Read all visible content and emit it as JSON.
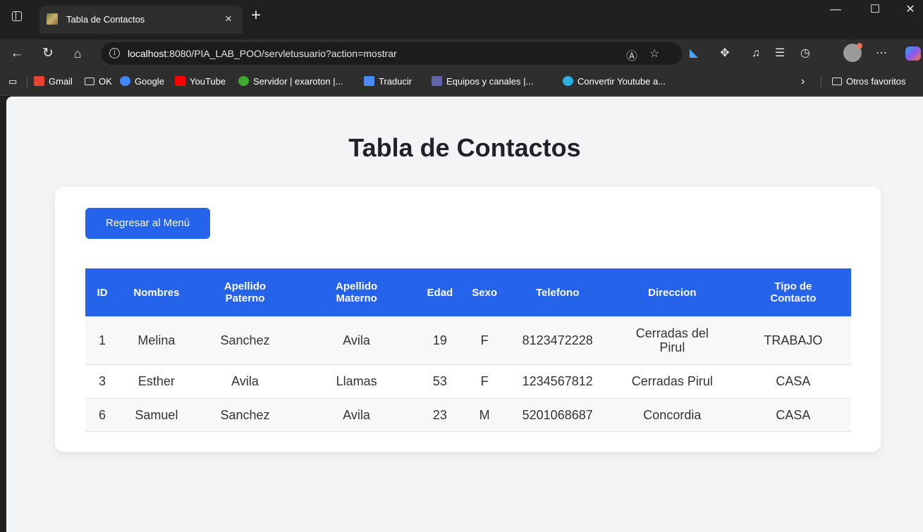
{
  "browser": {
    "tab_title": "Tabla de Contactos",
    "tab_close": "×",
    "new_tab": "+",
    "url_host": "localhost",
    "url_rest": ":8080/PIA_LAB_POO/servletusuario?action=mostrar",
    "bookmarks": [
      {
        "label": "Gmail",
        "icon": "gmail-icon",
        "color": "#ea4335"
      },
      {
        "label": "OK",
        "icon": "folder-icon",
        "color": "#e6e6e6"
      },
      {
        "label": "Google",
        "icon": "google-icon",
        "color": "#4285f4"
      },
      {
        "label": "YouTube",
        "icon": "youtube-icon",
        "color": "#ff0000"
      },
      {
        "label": "Servidor | exaroton |...",
        "icon": "exaroton-icon",
        "color": "#3fa82f"
      },
      {
        "label": "Traducir",
        "icon": "translate-icon",
        "color": "#4a8af4"
      },
      {
        "label": "Equipos y canales |...",
        "icon": "teams-icon",
        "color": "#6264a7"
      },
      {
        "label": "Convertir Youtube a...",
        "icon": "converter-icon",
        "color": "#2bb0e0"
      }
    ],
    "more_bookmarks": "›",
    "other_favorites": "Otros favoritos"
  },
  "page": {
    "title": "Tabla de Contactos",
    "back_button": "Regresar al Menú",
    "accent_color": "#2563eb"
  },
  "table": {
    "headers": [
      "ID",
      "Nombres",
      "Apellido Paterno",
      "Apellido Materno",
      "Edad",
      "Sexo",
      "Telefono",
      "Direccion",
      "Tipo de Contacto"
    ],
    "rows": [
      [
        "1",
        "Melina",
        "Sanchez",
        "Avila",
        "19",
        "F",
        "8123472228",
        "Cerradas del Pirul",
        "TRABAJO"
      ],
      [
        "3",
        "Esther",
        "Avila",
        "Llamas",
        "53",
        "F",
        "1234567812",
        "Cerradas Pirul",
        "CASA"
      ],
      [
        "6",
        "Samuel",
        "Sanchez",
        "Avila",
        "23",
        "M",
        "5201068687",
        "Concordia",
        "CASA"
      ]
    ]
  }
}
